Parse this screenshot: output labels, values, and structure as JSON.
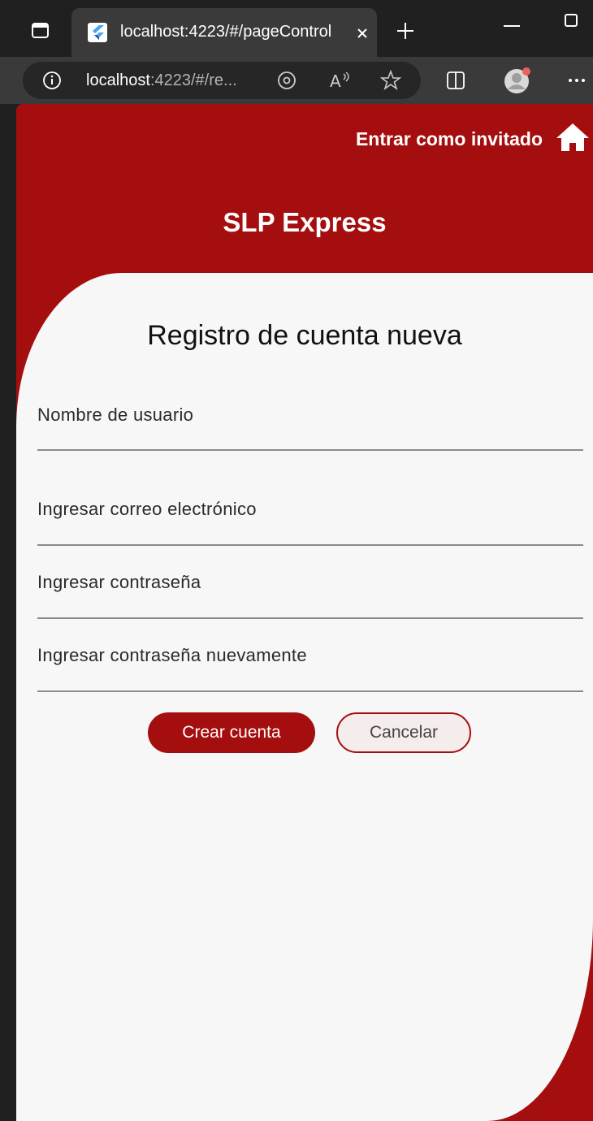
{
  "browser": {
    "tab_title": "localhost:4223/#/pageControl",
    "url_host": "localhost",
    "url_rest": ":4223/#/re...",
    "icons": [
      "tab-actions-icon",
      "flutter-favicon",
      "close-tab-icon",
      "new-tab-icon",
      "minimize-icon",
      "maximize-icon",
      "info-icon",
      "location-icon",
      "read-aloud-icon",
      "favorite-star-icon",
      "split-screen-icon",
      "profile-avatar",
      "more-options-icon"
    ]
  },
  "app": {
    "guest_label": "Entrar como invitado",
    "brand": "SLP Express",
    "form_title": "Registro de cuenta nueva",
    "fields": [
      {
        "label": "Nombre de usuario"
      },
      {
        "label": "Ingresar correo electrónico"
      },
      {
        "label": "Ingresar contraseña"
      },
      {
        "label": "Ingresar contraseña nuevamente"
      }
    ],
    "create_button": "Crear cuenta",
    "cancel_button": "Cancelar"
  },
  "colors": {
    "brand_red": "#a50e0e",
    "card_bg": "#f7f7f7",
    "chrome_dark": "#202020",
    "chrome_tab": "#3a3a3a"
  }
}
